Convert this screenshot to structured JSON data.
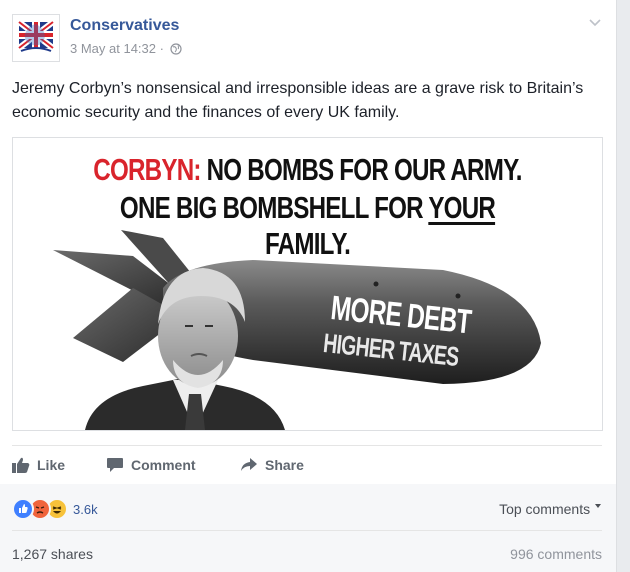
{
  "post": {
    "page_name": "Conservatives",
    "timestamp": "3 May at 14:32",
    "separator": "·",
    "privacy_icon": "globe-icon",
    "menu_icon": "chevron-down-icon",
    "text": "Jeremy Corbyn’s nonsensical and irresponsible ideas are a grave risk to Britain’s economic security and the finances of every UK family."
  },
  "image": {
    "line1_red": "CORBYN:",
    "line1_rest": " NO BOMBS FOR OUR ARMY.",
    "line2_pre": "ONE BIG BOMBSHELL FOR ",
    "line2_underline": "YOUR",
    "line2_post": " FAMILY.",
    "bomb_line1": "MORE DEBT",
    "bomb_line2": "HIGHER TAXES"
  },
  "actions": {
    "like": "Like",
    "comment": "Comment",
    "share": "Share"
  },
  "stats": {
    "reaction_count": "3.6k",
    "top_comments": "Top comments",
    "shares": "1,267 shares",
    "comments": "996 comments"
  },
  "colors": {
    "brand_blue": "#365899",
    "headline_red": "#d9242c",
    "like_blue": "#4080ff"
  }
}
